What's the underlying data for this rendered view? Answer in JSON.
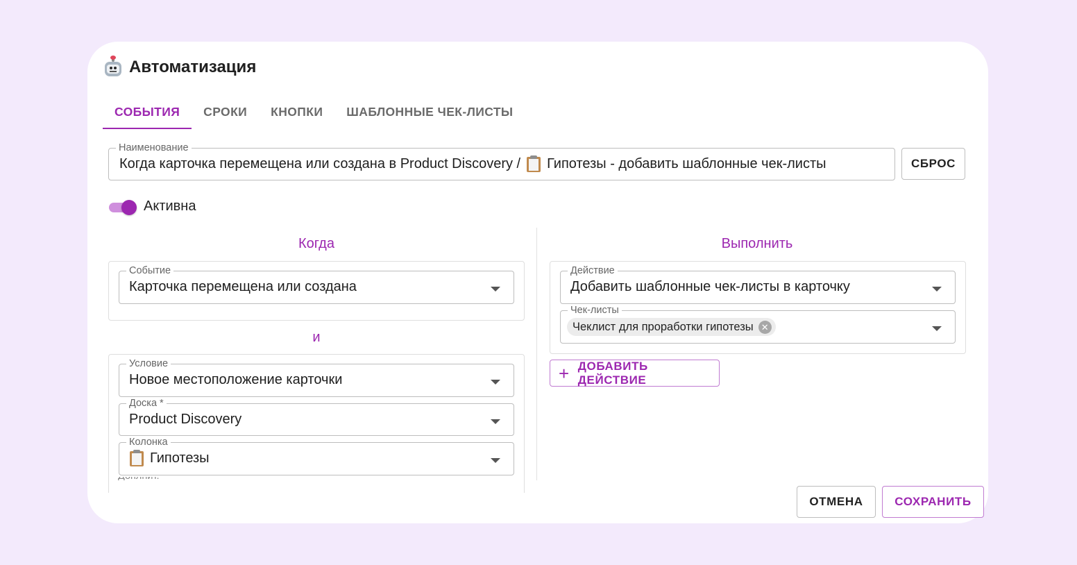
{
  "dialog": {
    "title": "Автоматизация"
  },
  "tabs": [
    {
      "label": "СОБЫТИЯ",
      "active": true
    },
    {
      "label": "СРОКИ",
      "active": false
    },
    {
      "label": "КНОПКИ",
      "active": false
    },
    {
      "label": "ШАБЛОННЫЕ ЧЕК-ЛИСТЫ",
      "active": false
    }
  ],
  "name_field": {
    "label": "Наименование",
    "value_prefix": "Когда карточка перемещена или создана в Product Discovery /",
    "value_suffix": "Гипотезы - добавить шаблонные чек-листы"
  },
  "reset_button": "СБРОС",
  "active_toggle": {
    "label": "Активна",
    "on": true
  },
  "when": {
    "heading": "Когда",
    "event": {
      "label": "Событие",
      "value": "Карточка перемещена или создана"
    },
    "and_label": "и",
    "condition": {
      "label": "Условие",
      "value": "Новое местоположение карточки"
    },
    "board": {
      "label": "Доска *",
      "value": "Product Discovery"
    },
    "column": {
      "label": "Колонка",
      "value": "Гипотезы"
    }
  },
  "execute": {
    "heading": "Выполнить",
    "action": {
      "label": "Действие",
      "value": "Добавить шаблонные чек-листы в карточку"
    },
    "checklists": {
      "label": "Чек-листы",
      "chips": [
        "Чеклист для проработки гипотезы"
      ]
    },
    "add_action_button": "ДОБАВИТЬ ДЕЙСТВИЕ"
  },
  "footer": {
    "cancel": "ОТМЕНА",
    "save": "СОХРАНИТЬ"
  },
  "colors": {
    "accent": "#9c27b0",
    "page_bg": "#f3eafc",
    "dialog_bg": "#ffffff"
  },
  "icons": [
    "robot-icon",
    "clipboard-icon",
    "chevron-down-icon",
    "plus-icon",
    "chip-remove-icon"
  ]
}
